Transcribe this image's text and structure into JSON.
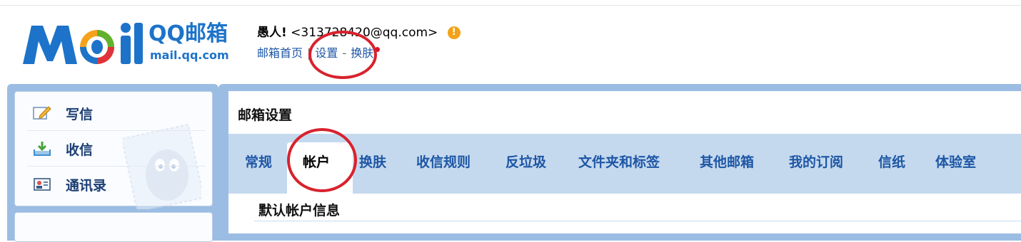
{
  "logo": {
    "brand": "QQ邮箱",
    "url": "mail.qq.com",
    "colors": {
      "blue": "#1d73c9",
      "orange": "#f5a21b",
      "green": "#62b22f",
      "red": "#e0323b"
    }
  },
  "user": {
    "name": "愚人!",
    "email": "<313728420@qq.com>",
    "badge_icon": "warning-icon",
    "badge_text": "!"
  },
  "top_links": {
    "home": "邮箱首页",
    "sep1": "|",
    "settings": "设置",
    "sep2": "-",
    "skin": "换肤"
  },
  "left_nav": {
    "items": [
      {
        "label": "写信",
        "icon": "compose-icon"
      },
      {
        "label": "收信",
        "icon": "inbox-download-icon"
      },
      {
        "label": "通讯录",
        "icon": "contacts-card-icon"
      }
    ]
  },
  "main": {
    "title": "邮箱设置",
    "tabs": [
      "常规",
      "帐户",
      "换肤",
      "收信规则",
      "反垃圾",
      "文件夹和标签",
      "其他邮箱",
      "我的订阅",
      "信纸",
      "体验室"
    ],
    "active_tab": "帐户",
    "section_title": "默认帐户信息"
  },
  "annotations": {
    "circle_color": "#d8222d"
  }
}
